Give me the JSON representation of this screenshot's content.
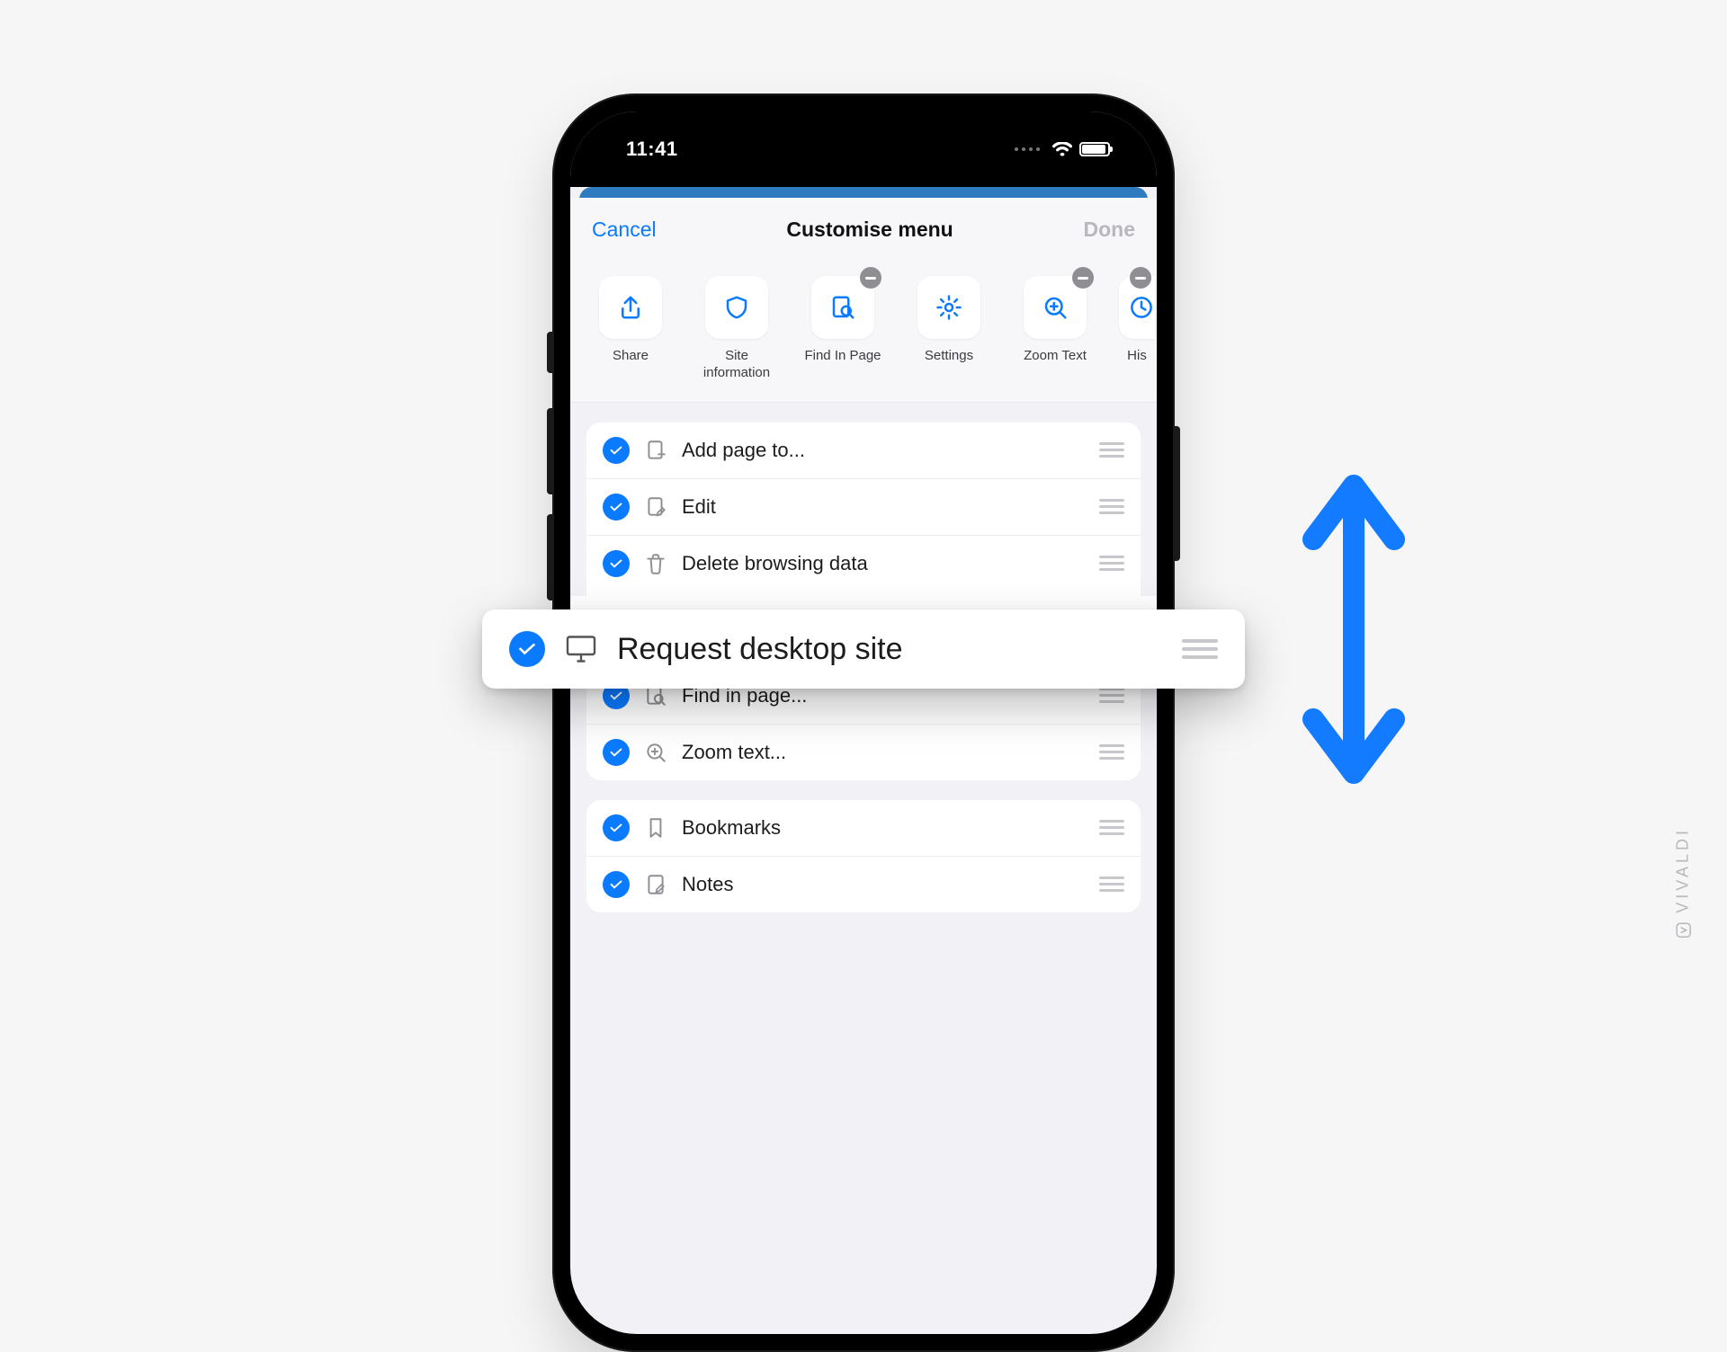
{
  "status": {
    "time": "11:41"
  },
  "header": {
    "cancel": "Cancel",
    "title": "Customise menu",
    "done": "Done"
  },
  "cards": [
    {
      "label": "Share",
      "icon": "share",
      "removable": false,
      "cut": false
    },
    {
      "label": "Site information",
      "icon": "shield",
      "removable": false,
      "cut": false
    },
    {
      "label": "Find In Page",
      "icon": "find",
      "removable": true,
      "cut": false
    },
    {
      "label": "Settings",
      "icon": "gear",
      "removable": false,
      "cut": false
    },
    {
      "label": "Zoom Text",
      "icon": "zoom",
      "removable": true,
      "cut": false
    },
    {
      "label": "His",
      "icon": "history",
      "removable": true,
      "cut": true
    }
  ],
  "group1": [
    {
      "label": "Add page to...",
      "icon": "add-page"
    },
    {
      "label": "Edit",
      "icon": "edit"
    },
    {
      "label": "Delete browsing data",
      "icon": "trash"
    },
    {
      "label": "Find in page...",
      "icon": "find"
    },
    {
      "label": "Zoom text...",
      "icon": "zoom"
    }
  ],
  "group2": [
    {
      "label": "Bookmarks",
      "icon": "bookmark"
    },
    {
      "label": "Notes",
      "icon": "notes"
    }
  ],
  "floating": {
    "label": "Request desktop site"
  },
  "watermark": "VIVALDI"
}
